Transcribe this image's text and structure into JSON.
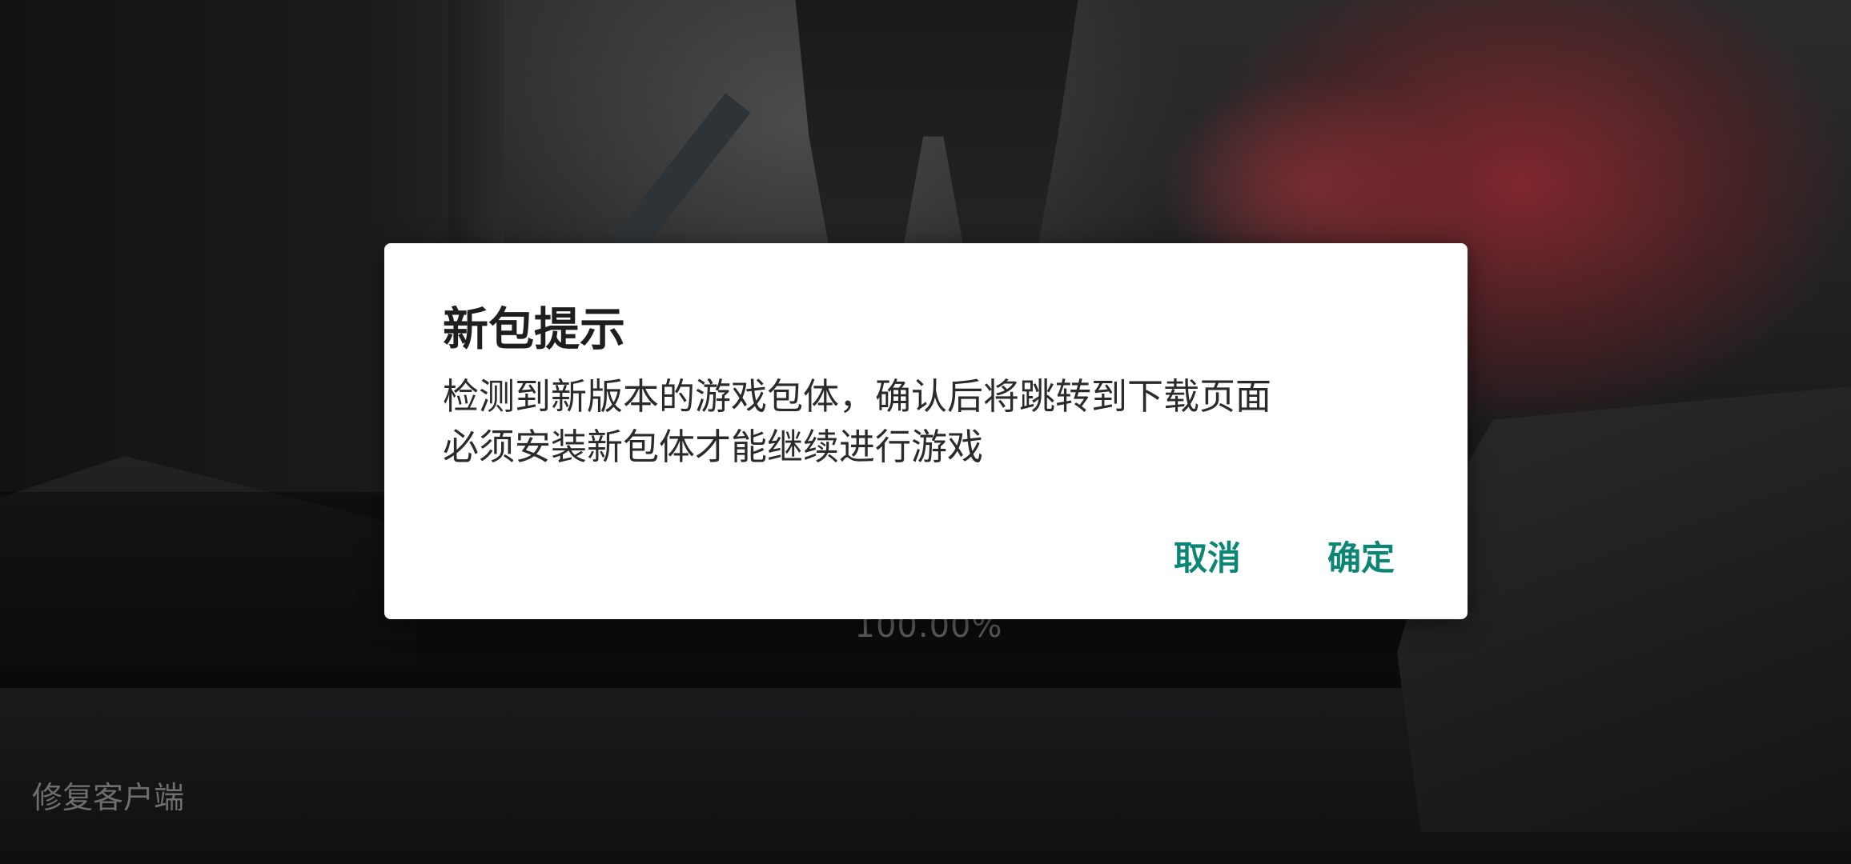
{
  "dialog": {
    "title": "新包提示",
    "message_lines": [
      "检测到新版本的游戏包体，确认后将跳转到下载页面",
      "必须安装新包体才能继续进行游戏"
    ],
    "cancel_label": "取消",
    "confirm_label": "确定"
  },
  "loading": {
    "progress_text": "100.00%"
  },
  "footer": {
    "repair_label": "修复客户端"
  },
  "colors": {
    "accent": "#0b8574",
    "dialog_background": "#ffffff"
  }
}
